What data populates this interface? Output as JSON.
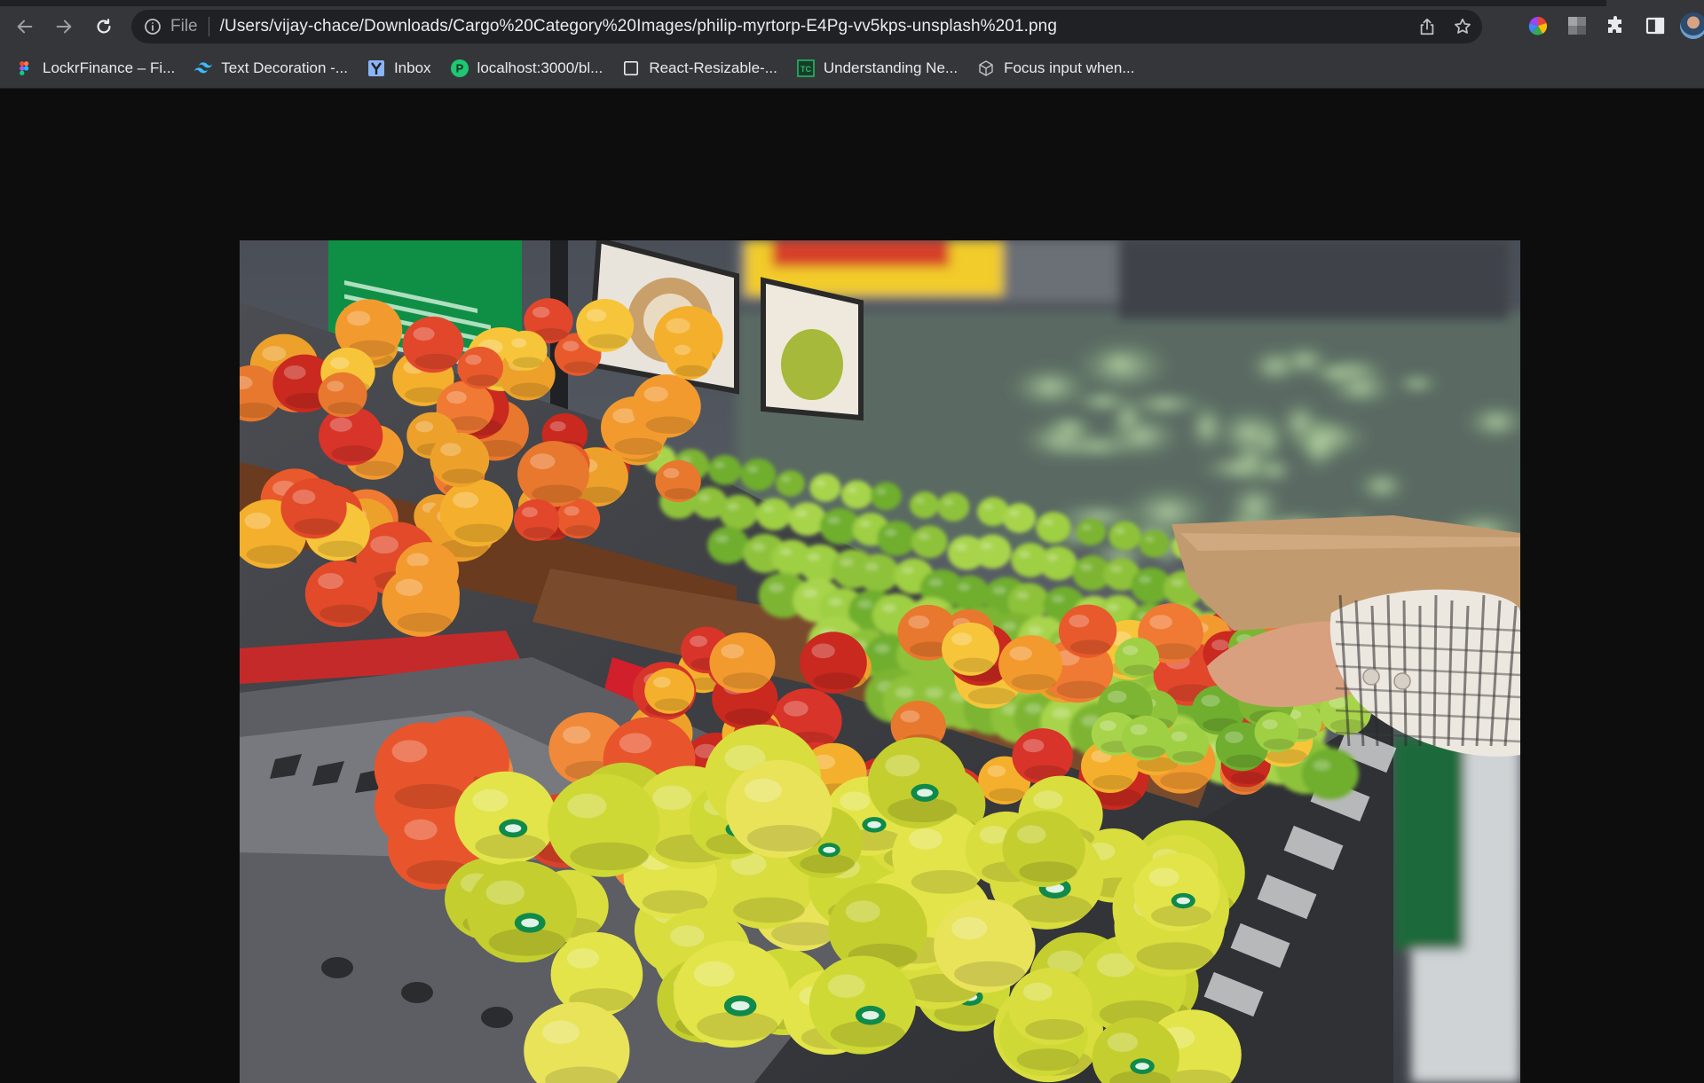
{
  "toolbar": {
    "back_icon": "arrow-left-icon",
    "forward_icon": "arrow-right-icon",
    "reload_icon": "reload-icon",
    "site_info_icon": "info-icon",
    "scheme_label": "File",
    "url": "/Users/vijay-chace/Downloads/Cargo%20Category%20Images/philip-myrtorp-E4Pg-vv5kps-unsplash%201.png",
    "share_icon": "share-icon",
    "bookmark_icon": "star-icon"
  },
  "extensions": [
    {
      "name": "color-wheel-icon"
    },
    {
      "name": "gray-square-icon"
    },
    {
      "name": "puzzle-icon"
    },
    {
      "name": "side-panel-icon"
    }
  ],
  "bookmarks": [
    {
      "label": "LockrFinance – Fi...",
      "icon": "figma-icon"
    },
    {
      "label": "Text Decoration -...",
      "icon": "tailwind-icon"
    },
    {
      "label": "Inbox",
      "icon": "y-mail-icon"
    },
    {
      "label": "localhost:3000/bl...",
      "icon": "p-circle-icon"
    },
    {
      "label": "React-Resizable-...",
      "icon": "blank-page-icon"
    },
    {
      "label": "Understanding Ne...",
      "icon": "tc-icon"
    },
    {
      "label": "Focus input when...",
      "icon": "cube-icon"
    }
  ],
  "image": {
    "alt": "philip-myrtorp-E4Pg-vv5kps-unsplash 1.png",
    "colors": {
      "background": "#0d0d0e",
      "toolbar": "#35363a",
      "omnibox": "#202124",
      "sign_green": "#0f8f45",
      "price_yellow": "#f2cc2a"
    }
  }
}
